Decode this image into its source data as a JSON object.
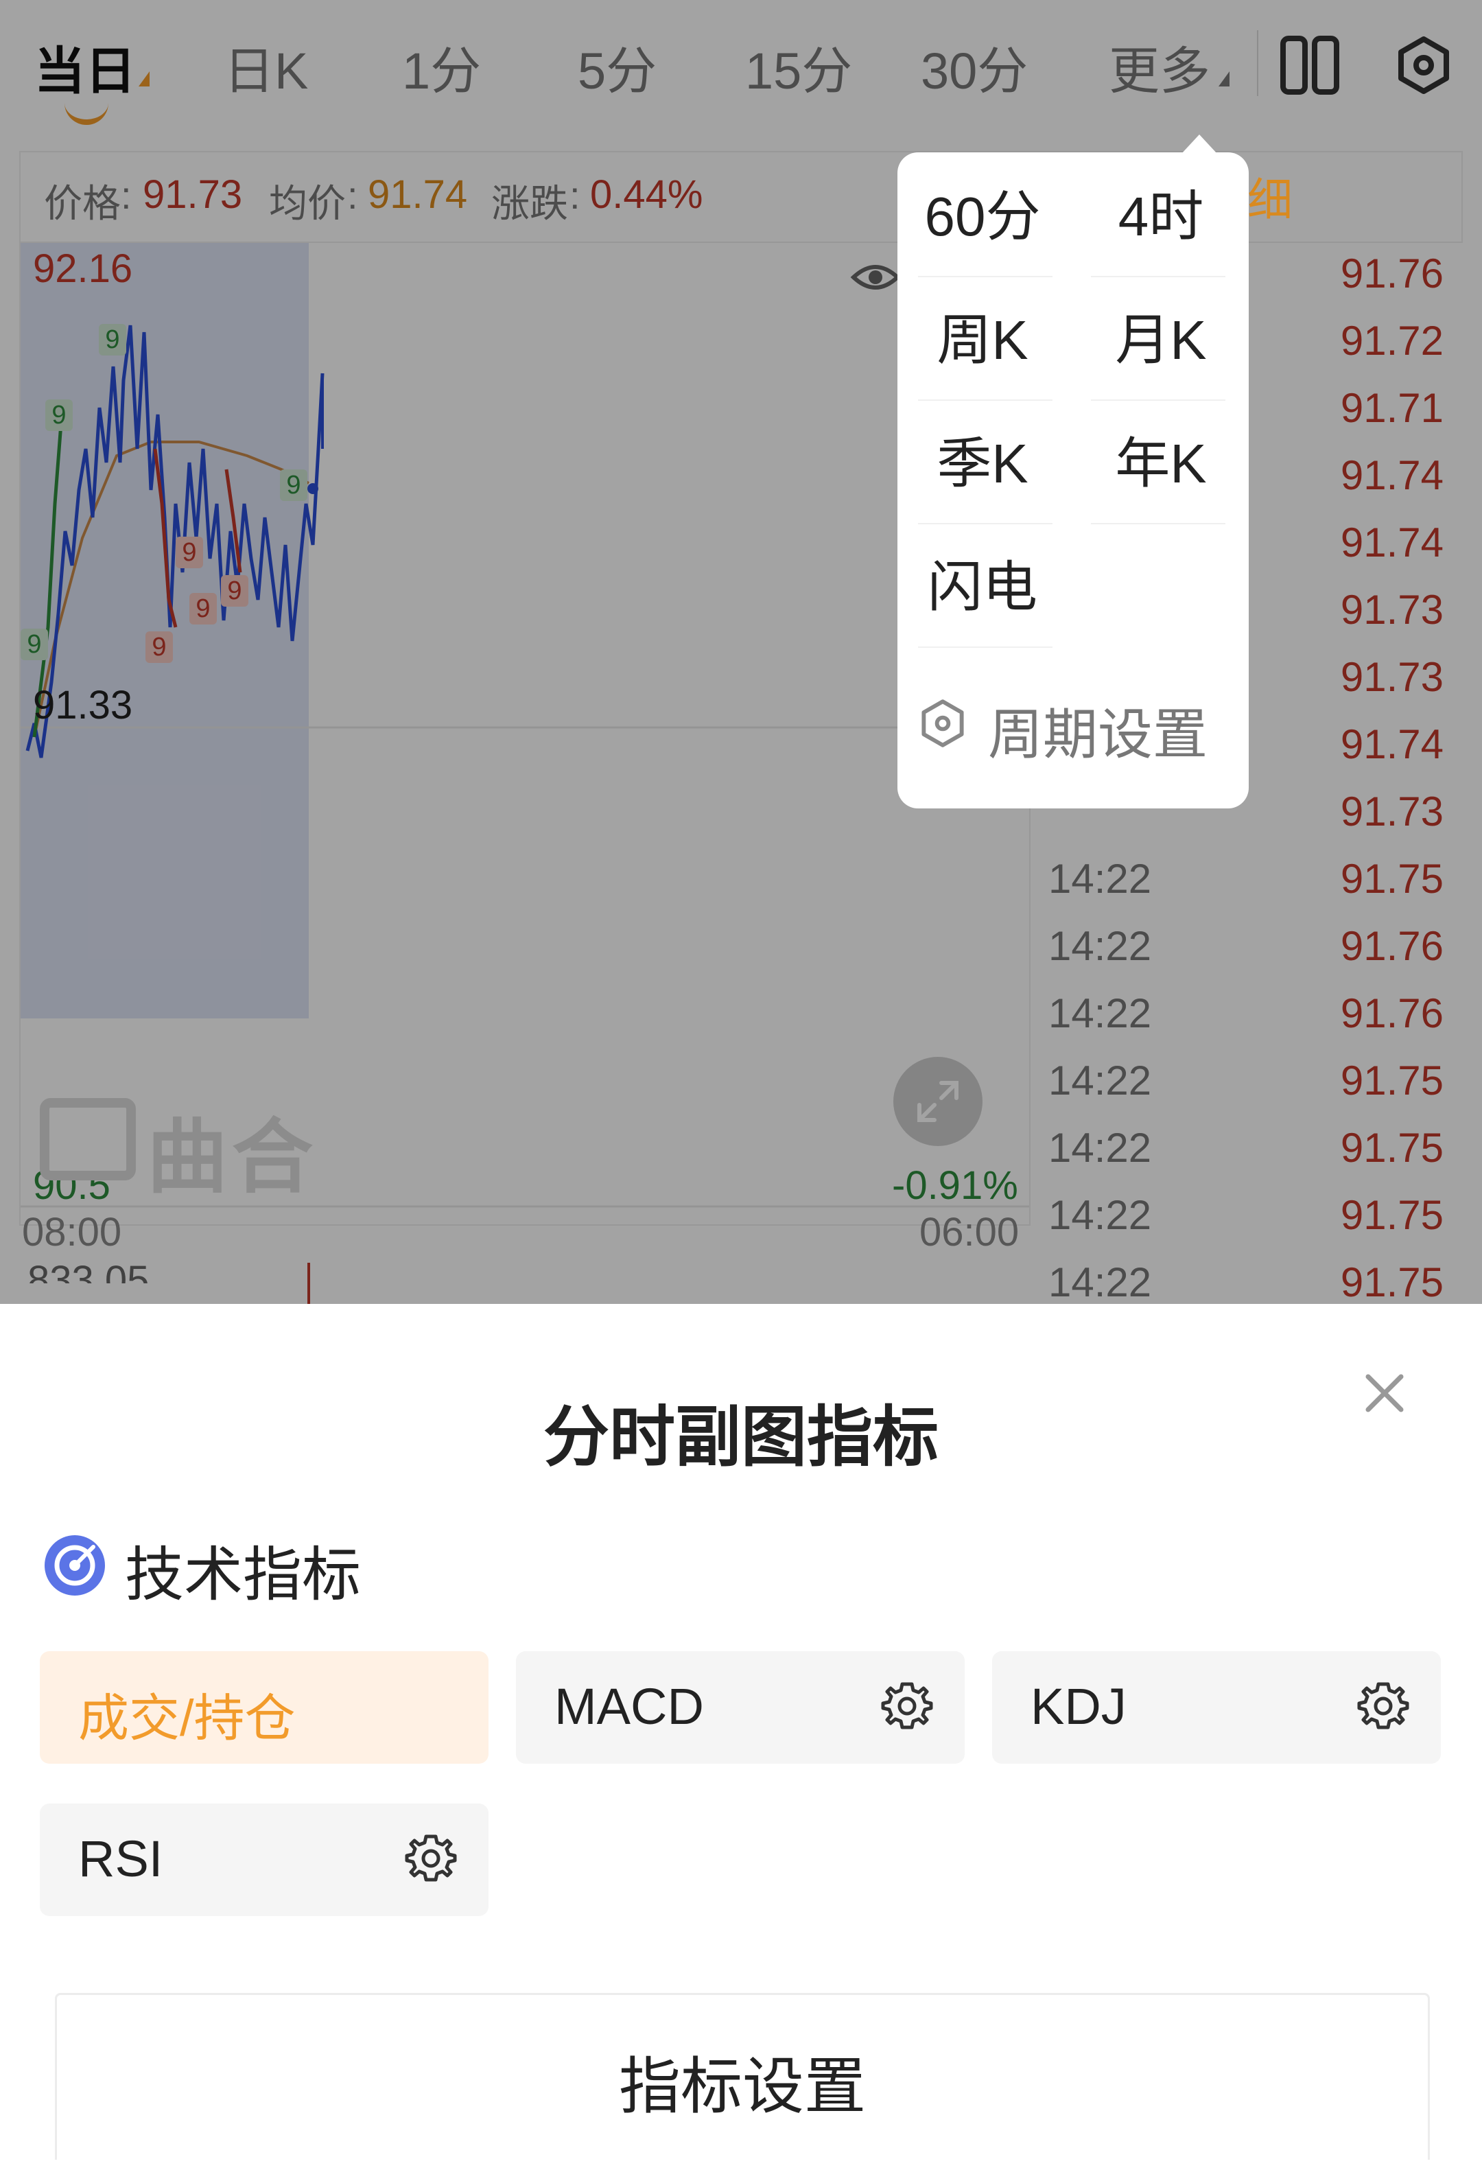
{
  "tabs": {
    "items": [
      {
        "label": "当日"
      },
      {
        "label": "日K"
      },
      {
        "label": "1分"
      },
      {
        "label": "5分"
      },
      {
        "label": "15分"
      },
      {
        "label": "30分"
      },
      {
        "label": "更多"
      }
    ],
    "active_index": 0
  },
  "icons": {
    "layout": "split-view-icon",
    "settings": "settings-hex-icon",
    "eye": "eye-icon",
    "expand": "expand-icon",
    "close": "close-icon",
    "section": "target-icon",
    "gear": "gear-icon"
  },
  "price_bar": {
    "price_label": "价格",
    "price_value": "91.73",
    "avg_label": "均价",
    "avg_value": "91.74",
    "change_label": "涨跌",
    "change_value": "0.44%"
  },
  "chart": {
    "y_max": "92.16",
    "y_mid": "91.33",
    "y_min": "90.5",
    "pct_min": "-0.91%",
    "x_start": "08:00",
    "x_end": "06:00",
    "bottom_cut": "833.05",
    "watermark": "曲合",
    "nine_marker": "9"
  },
  "ticker_header_partial": "细",
  "ticker": [
    {
      "time": "",
      "price": "91.76"
    },
    {
      "time": "",
      "price": "91.72"
    },
    {
      "time": "",
      "price": "91.71"
    },
    {
      "time": "",
      "price": "91.74"
    },
    {
      "time": "",
      "price": "91.74"
    },
    {
      "time": "",
      "price": "91.73"
    },
    {
      "time": "",
      "price": "91.73"
    },
    {
      "time": "",
      "price": "91.74"
    },
    {
      "time": "",
      "price": "91.73"
    },
    {
      "time": "14:22",
      "price": "91.75"
    },
    {
      "time": "14:22",
      "price": "91.76"
    },
    {
      "time": "14:22",
      "price": "91.76"
    },
    {
      "time": "14:22",
      "price": "91.75"
    },
    {
      "time": "14:22",
      "price": "91.75"
    },
    {
      "time": "14:22",
      "price": "91.75"
    },
    {
      "time": "14:22",
      "price": "91.75"
    }
  ],
  "more_menu": {
    "items": [
      {
        "label": "60分"
      },
      {
        "label": "4时"
      },
      {
        "label": "周K"
      },
      {
        "label": "月K"
      },
      {
        "label": "季K"
      },
      {
        "label": "年K"
      },
      {
        "label": "闪电"
      }
    ],
    "period_settings": "周期设置"
  },
  "sheet": {
    "title": "分时副图指标",
    "section_title": "技术指标",
    "chips": [
      {
        "label": "成交/持仓",
        "selected": true,
        "has_gear": false
      },
      {
        "label": "MACD",
        "selected": false,
        "has_gear": true
      },
      {
        "label": "KDJ",
        "selected": false,
        "has_gear": true
      },
      {
        "label": "RSI",
        "selected": false,
        "has_gear": true
      }
    ],
    "settings_button": "指标设置"
  },
  "colors": {
    "accent": "#F29B2B",
    "up_red": "#C0392B",
    "down_green": "#2E8B3E",
    "line_blue": "#2B4FD6",
    "avg_orange": "#C98A4B",
    "chip_selected_bg": "#FFF1E4"
  }
}
